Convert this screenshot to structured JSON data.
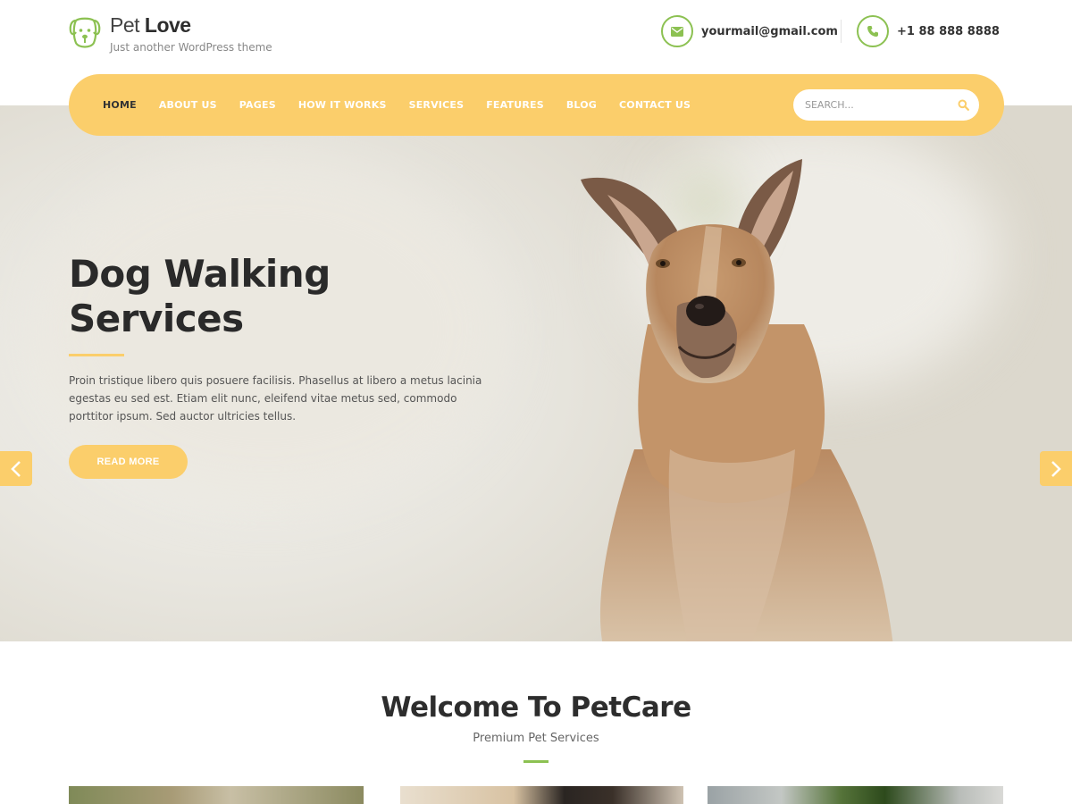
{
  "site": {
    "logo_name_light": "Pet",
    "logo_name_bold": "Love",
    "tagline": "Just another WordPress theme"
  },
  "contact": {
    "email": "yourmail@gmail.com",
    "phone": "+1 88 888 8888"
  },
  "nav": {
    "items": [
      {
        "label": "HOME",
        "active": true
      },
      {
        "label": "ABOUT US",
        "active": false
      },
      {
        "label": "PAGES",
        "active": false
      },
      {
        "label": "HOW IT WORKS",
        "active": false
      },
      {
        "label": "SERVICES",
        "active": false
      },
      {
        "label": "FEATURES",
        "active": false
      },
      {
        "label": "BLOG",
        "active": false
      },
      {
        "label": "CONTACT US",
        "active": false
      }
    ],
    "search_placeholder": "SEARCH..."
  },
  "hero": {
    "title_line1": "Dog Walking",
    "title_line2": "Services",
    "description": "Proin tristique libero quis posuere facilisis. Phasellus at libero a metus lacinia egestas eu sed est. Etiam elit nunc, eleifend vitae metus sed, commodo porttitor ipsum. Sed auctor ultricies tellus.",
    "button_label": "READ MORE"
  },
  "welcome": {
    "title": "Welcome To PetCare",
    "subtitle": "Premium Pet Services"
  },
  "colors": {
    "accent_yellow": "#fbce6b",
    "accent_green": "#8cc152",
    "text_dark": "#2d2d2d"
  },
  "icons": {
    "logo": "dog-face-icon",
    "email": "envelope-icon",
    "phone": "phone-icon",
    "search": "search-icon",
    "prev": "chevron-left-icon",
    "next": "chevron-right-icon"
  }
}
